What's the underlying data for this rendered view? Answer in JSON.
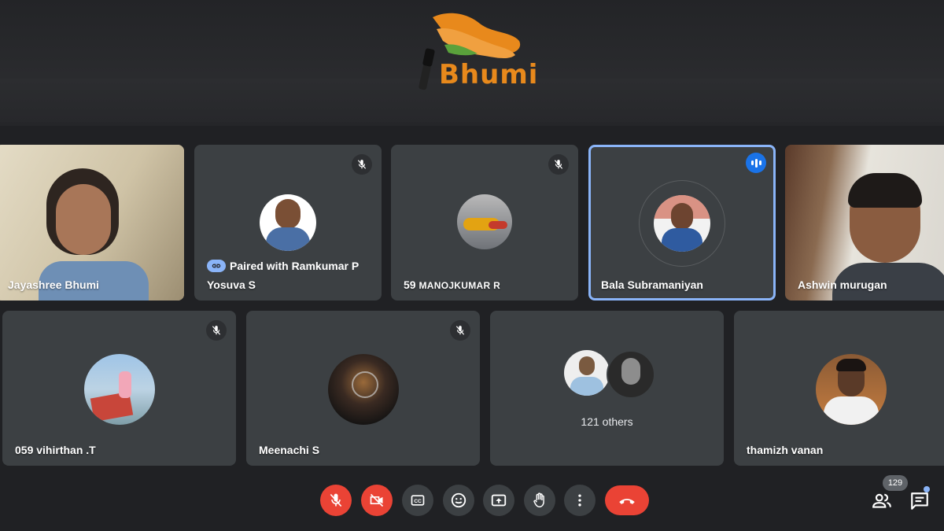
{
  "banner": {
    "logo_text": "Bhumi"
  },
  "participants": {
    "row1": [
      {
        "name": "Jayashree Bhumi",
        "video": true
      },
      {
        "name": "Yosuva S",
        "paired_label": "Paired with Ramkumar P",
        "muted": true
      },
      {
        "name": "59 MANOJKUMAR R",
        "muted": true
      },
      {
        "name": "Bala Subramaniyan",
        "speaking": true
      },
      {
        "name": "Ashwin murugan",
        "video": true
      }
    ],
    "row2": [
      {
        "name": "059 vihirthan .T",
        "muted": true
      },
      {
        "name": "Meenachi S",
        "muted": true
      },
      {
        "others_label": "121 others"
      },
      {
        "name": "thamizh vanan"
      }
    ]
  },
  "controls": {
    "buttons": [
      {
        "icon": "mic-off-icon",
        "state": "off"
      },
      {
        "icon": "camera-off-icon",
        "state": "off"
      },
      {
        "icon": "captions-icon"
      },
      {
        "icon": "emoji-icon"
      },
      {
        "icon": "present-icon"
      },
      {
        "icon": "raise-hand-icon"
      },
      {
        "icon": "more-options-icon"
      },
      {
        "icon": "end-call-icon"
      }
    ],
    "people_count": "129"
  },
  "colors": {
    "background": "#202124",
    "tile": "#3c4043",
    "danger": "#ea4335",
    "accent": "#8ab4f8",
    "brand": "#e8891c"
  }
}
